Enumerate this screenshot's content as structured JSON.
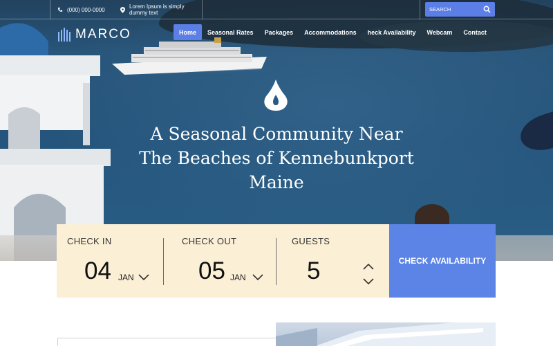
{
  "topbar": {
    "phone": "(000) 000-0000",
    "address_line1": "Lorem Ipsum is simply",
    "address_line2": "dummy text",
    "search_placeholder": "SEARCH"
  },
  "logo": {
    "text": "MARCO"
  },
  "nav": {
    "items": [
      {
        "label": "Home",
        "active": true
      },
      {
        "label": "Seasonal Rates"
      },
      {
        "label": "Packages"
      },
      {
        "label": "Accommodations"
      },
      {
        "label": "heck Availability"
      },
      {
        "label": "Webcam"
      },
      {
        "label": "Contact"
      }
    ]
  },
  "hero": {
    "headline_line1": "A Seasonal Community Near",
    "headline_line2": "The Beaches of Kennebunkport",
    "headline_line3": "Maine",
    "icon": "water-drop-icon"
  },
  "booking": {
    "check_in_label": "CHECK IN",
    "check_in_day": "04",
    "check_in_month": "JAN",
    "check_out_label": "CHECK OUT",
    "check_out_day": "05",
    "check_out_month": "JAN",
    "guests_label": "GUESTS",
    "guests_value": "5",
    "button_label": "CHECK AVAILABILITY"
  },
  "colors": {
    "accent": "#5b7fe6",
    "booking_bg": "#fbefd6"
  }
}
